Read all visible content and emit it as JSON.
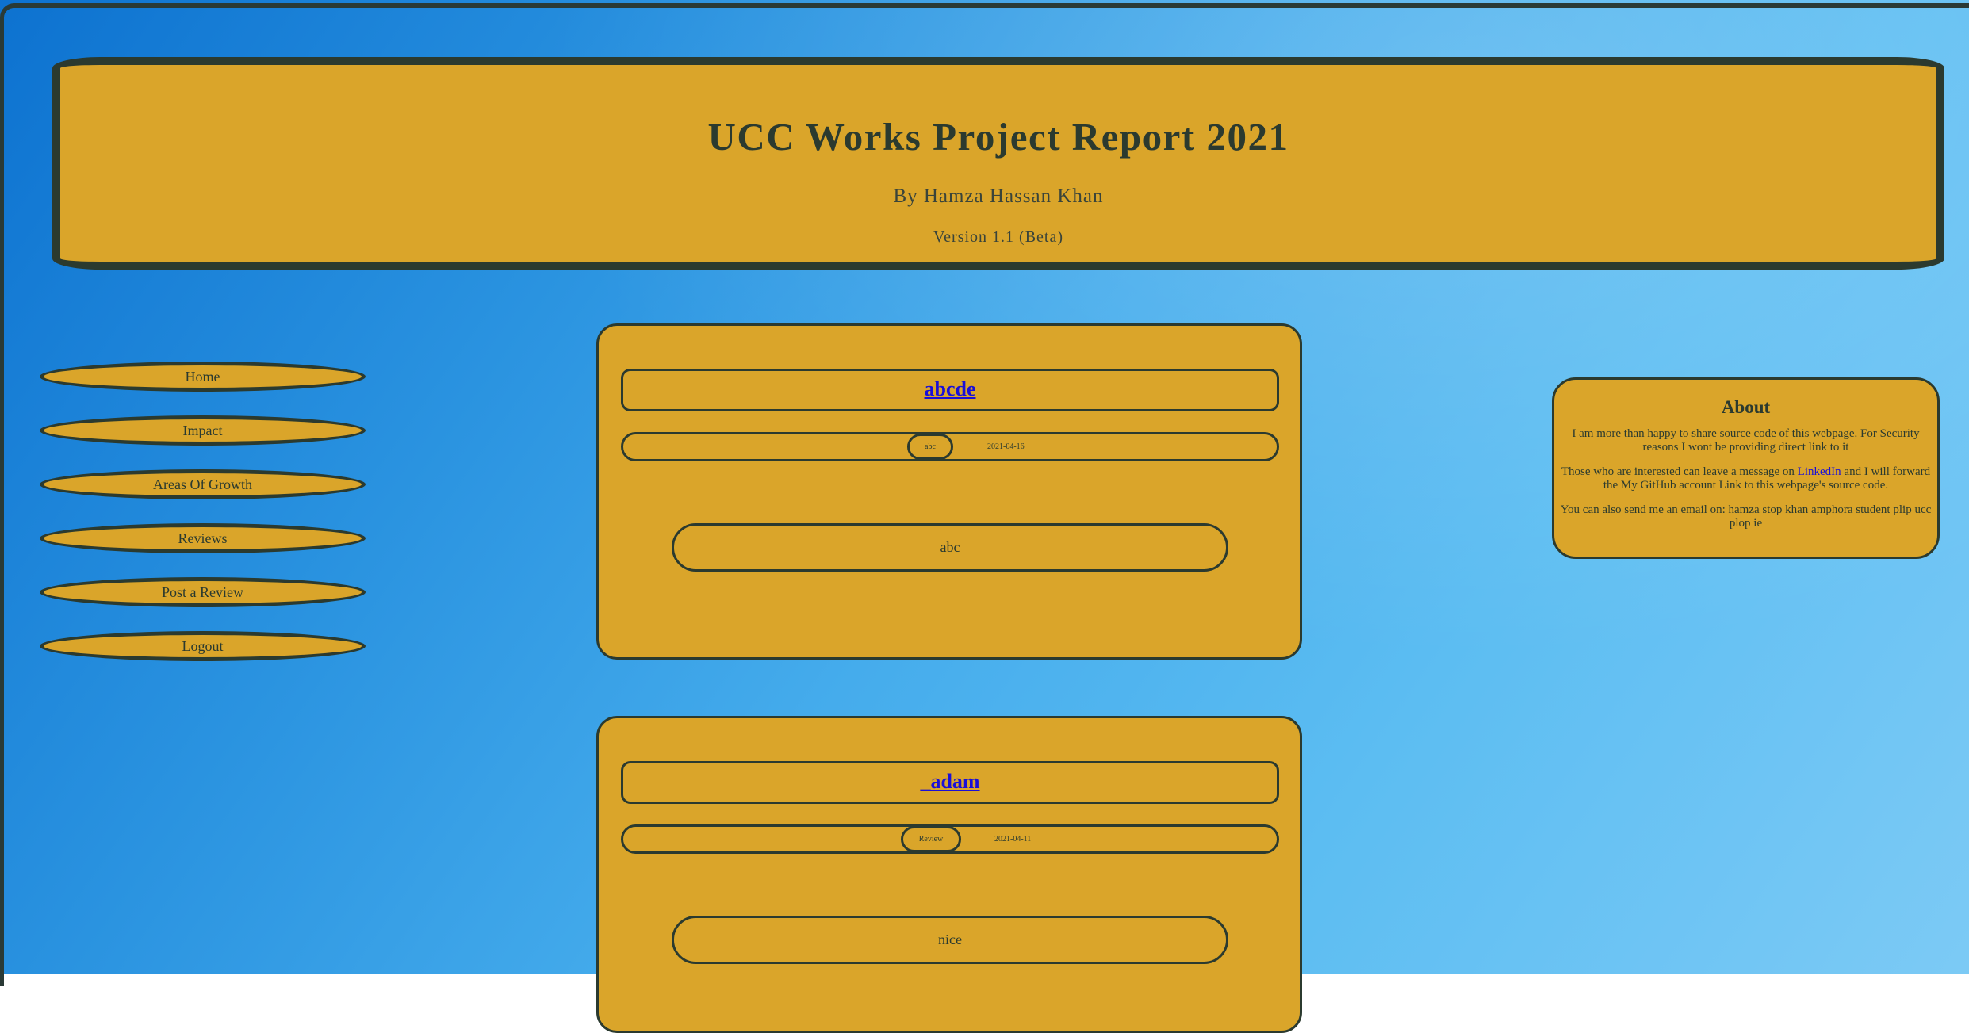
{
  "header": {
    "title": "UCC Works Project Report 2021",
    "author": "By Hamza Hassan Khan",
    "version": "Version 1.1 (Beta)"
  },
  "nav": {
    "items": [
      {
        "label": "Home"
      },
      {
        "label": "Impact"
      },
      {
        "label": "Areas Of Growth"
      },
      {
        "label": "Reviews"
      },
      {
        "label": "Post a Review"
      },
      {
        "label": "Logout"
      }
    ]
  },
  "reviews": [
    {
      "title": "abcde",
      "tag": "abc",
      "date": "2021-04-16",
      "body": "abc"
    },
    {
      "title": "_adam",
      "tag": "Review",
      "date": "2021-04-11",
      "body": "nice"
    }
  ],
  "about": {
    "heading": "About",
    "para1": "I am more than happy to share source code of this webpage. For Security reasons I wont be providing direct link to it",
    "para2_before": "Those who are interested can leave a message on ",
    "para2_link": "LinkedIn",
    "para2_after": " and I will forward the My GitHub account Link to this webpage's source code.",
    "para3": "You can also send me an email on: hamza stop khan amphora student plip ucc plop ie"
  },
  "colors": {
    "panel": "#daa52a",
    "border": "#2b3a2f",
    "link": "#1a0fd8"
  }
}
